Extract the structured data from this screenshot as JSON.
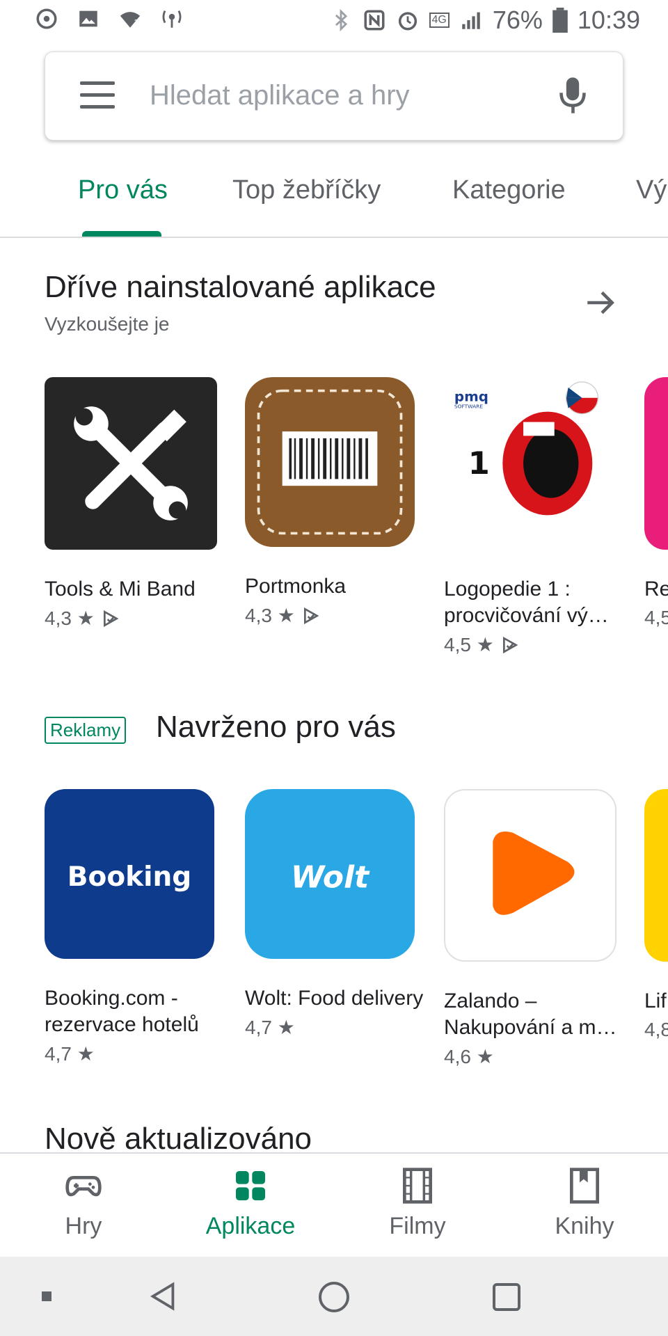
{
  "status_bar": {
    "battery": "76%",
    "time": "10:39",
    "network": "4G"
  },
  "search": {
    "placeholder": "Hledat aplikace a hry"
  },
  "tabs": [
    "Pro vás",
    "Top žebříčky",
    "Kategorie",
    "Vý"
  ],
  "section1": {
    "title": "Dříve nainstalované aplikace",
    "subtitle": "Vyzkoušejte je",
    "apps": [
      {
        "name": "Tools & Mi Band",
        "rating": "4,3 ★"
      },
      {
        "name": "Portmonka",
        "rating": "4,3 ★"
      },
      {
        "name": "Logopedie 1 : procvičování vý…",
        "rating": "4,5 ★"
      },
      {
        "name": "Re",
        "rating": "4,5"
      }
    ]
  },
  "section2": {
    "badge": "Reklamy",
    "title": "Navrženo pro vás",
    "apps": [
      {
        "name": "Booking.com - rezervace hotelů",
        "rating": "4,7 ★",
        "icon_text": "Booking"
      },
      {
        "name": "Wolt: Food delivery",
        "rating": "4,7 ★",
        "icon_text": "Wolt"
      },
      {
        "name": "Zalando – Nakupování a m…",
        "rating": "4,6 ★"
      },
      {
        "name": "Lif",
        "rating": "4,8"
      }
    ]
  },
  "section3": {
    "title": "Nově aktualizováno"
  },
  "bottom_nav": {
    "items": [
      "Hry",
      "Aplikace",
      "Filmy",
      "Knihy"
    ]
  },
  "logopedie_icon": {
    "brand": "pmq",
    "brand_sub": "SOFTWARE",
    "number": "1"
  },
  "colors": {
    "accent": "#01875f",
    "booking": "#0e3b8c",
    "wolt": "#2aa8e6",
    "zalando": "#ff6900",
    "portmonka": "#8b5a2b"
  }
}
